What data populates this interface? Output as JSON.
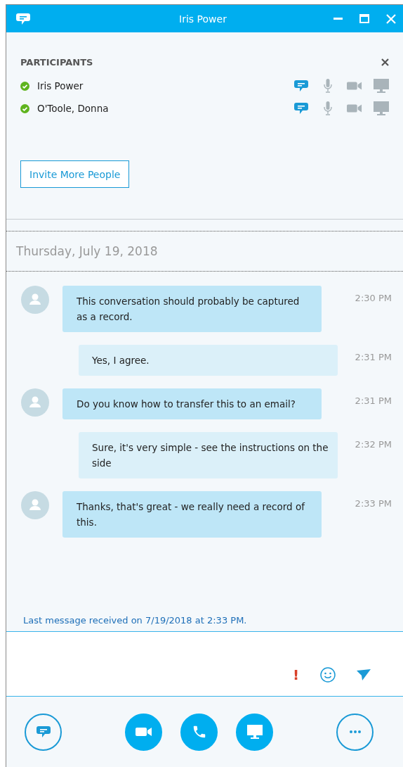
{
  "window": {
    "title": "Iris Power"
  },
  "participants": {
    "heading": "PARTICIPANTS",
    "people": [
      {
        "name": "Iris Power",
        "online": true,
        "modes": [
          {
            "kind": "chat",
            "active": true
          },
          {
            "kind": "audio",
            "active": false
          },
          {
            "kind": "video",
            "active": false
          },
          {
            "kind": "screen",
            "active": false
          }
        ]
      },
      {
        "name": "O'Toole, Donna",
        "online": true,
        "modes": [
          {
            "kind": "chat",
            "active": true
          },
          {
            "kind": "audio",
            "active": false
          },
          {
            "kind": "video",
            "active": false
          },
          {
            "kind": "screen",
            "active": false
          }
        ]
      }
    ],
    "invite_button": "Invite More People"
  },
  "date_header": "Thursday, July 19, 2018",
  "messages": [
    {
      "kind": "incoming",
      "text": "This conversation should probably be captured as a record.",
      "time": "2:30 PM"
    },
    {
      "kind": "outgoing",
      "text": "Yes, I agree.",
      "time": "2:31 PM"
    },
    {
      "kind": "incoming",
      "text": "Do you know how to transfer this to an email?",
      "time": "2:31 PM"
    },
    {
      "kind": "outgoing",
      "text": "Sure, it's very simple - see the instructions on the side",
      "time": "2:32 PM"
    },
    {
      "kind": "incoming",
      "text": "Thanks, that's great - we really need a record of this.",
      "time": "2:33 PM"
    }
  ],
  "last_message_note": "Last message received on 7/19/2018 at 2:33 PM.",
  "compose": {
    "importance_mark": "!"
  },
  "bottom_bar": [
    {
      "kind": "im",
      "filled": false
    },
    {
      "kind": "video",
      "filled": true
    },
    {
      "kind": "call",
      "filled": true
    },
    {
      "kind": "screen",
      "filled": true
    },
    {
      "kind": "more",
      "filled": false
    }
  ]
}
